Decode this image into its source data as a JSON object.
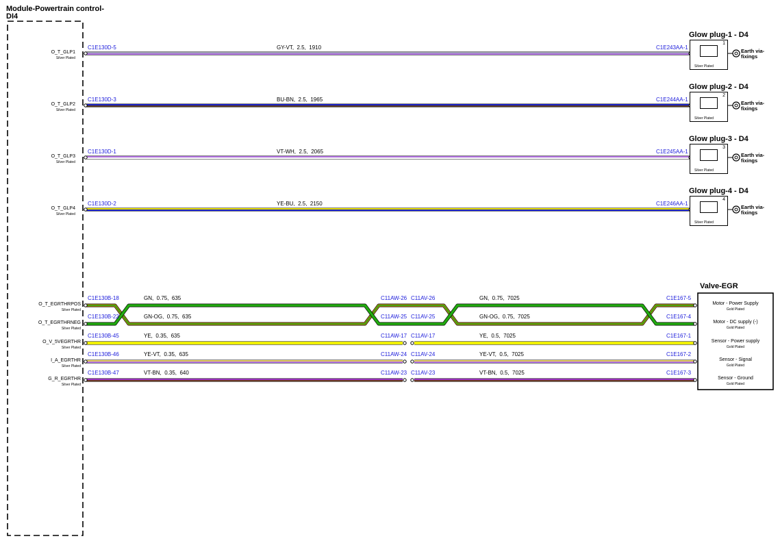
{
  "module": {
    "title_line1": "Module-Powertrain control-",
    "title_line2": "DI4"
  },
  "glow_wires": [
    {
      "pin": "O_T_GLP1",
      "plating": "Silver Plated",
      "from": "C1E130D-5",
      "spec": "GY-VT,  2.5,  1910",
      "to": "C1E243AA-1",
      "colors": [
        "#a0a0b8",
        "#b070e0"
      ],
      "plug": {
        "title": "Glow plug-1 - D4",
        "num": "1",
        "plating": "Silver Plated"
      },
      "earth": "Earth via-\nfixings"
    },
    {
      "pin": "O_T_GLP2",
      "plating": "Silver Plated",
      "from": "C1E130D-3",
      "spec": "BU-BN,  2.5,  1965",
      "to": "C1E244AA-1",
      "colors": [
        "#1a22c8",
        "#5a3a20"
      ],
      "plug": {
        "title": "Glow plug-2 - D4",
        "num": "2",
        "plating": "Silver Plated"
      },
      "earth": "Earth via-\nfixings"
    },
    {
      "pin": "O_T_GLP3",
      "plating": "Silver Plated",
      "from": "C1E130D-1",
      "spec": "VT-WH,  2.5,  2065",
      "to": "C1E245AA-1",
      "colors": [
        "#b070e0",
        "#ffffff"
      ],
      "plug": {
        "title": "Glow plug-3 - D4",
        "num": "3",
        "plating": "Silver Plated"
      },
      "earth": "Earth via-\nfixings"
    },
    {
      "pin": "O_T_GLP4",
      "plating": "Silver Plated",
      "from": "C1E130D-2",
      "spec": "YE-BU,  2.5,  2150",
      "to": "C1E246AA-1",
      "colors": [
        "#e8e000",
        "#1a22c8"
      ],
      "plug": {
        "title": "Glow plug-4 - D4",
        "num": "4",
        "plating": "Silver Plated"
      },
      "earth": "Earth via-\nfixings"
    }
  ],
  "egr": {
    "title": "Valve-EGR",
    "wires": [
      {
        "pin": "O_T_EGRTHRPOS",
        "plating": "Silver Plated",
        "from": "C1E130B-18",
        "spec1": "GN,  0.75,  635",
        "mid_a": "C11AW-26",
        "mid_b": "C11AV-26",
        "spec2": "GN,  0.75,  7025",
        "to": "C1E167-5",
        "func": "Motor - Power Supply",
        "func_plating": "Gold Plated",
        "colors": [
          "#22aa11",
          "#22aa11"
        ]
      },
      {
        "pin": "O_T_EGRTHRNEG",
        "plating": "Silver Plated",
        "from": "C1E130B-22",
        "spec1": "GN-OG,  0.75,  635",
        "mid_a": "C11AW-25",
        "mid_b": "C11AV-25",
        "spec2": "GN-OG,  0.75,  7025",
        "to": "C1E167-4",
        "func": "Motor - DC supply (-)",
        "func_plating": "Gold Plated",
        "colors": [
          "#22aa11",
          "#c08a10"
        ]
      },
      {
        "pin": "O_V_5VEGRTHR",
        "plating": "Silver Plated",
        "from": "C1E130B-45",
        "spec1": "YE,  0.35,  635",
        "mid_a": "C11AW-17",
        "mid_b": "C11AV-17",
        "spec2": "YE,  0.5,  7025",
        "to": "C1E167-1",
        "func": "Sensor - Power supply",
        "func_plating": "Gold Plated",
        "colors": [
          "#f0f000",
          "#f0f000"
        ]
      },
      {
        "pin": "I_A_EGRTHR",
        "plating": "Silver Plated",
        "from": "C1E130B-46",
        "spec1": "YE-VT,  0.35,  635",
        "mid_a": "C11AW-24",
        "mid_b": "C11AV-24",
        "spec2": "YE-VT,  0.5,  7025",
        "to": "C1E167-2",
        "func": "Sensor - Signal",
        "func_plating": "Gold Plated",
        "colors": [
          "#e8d060",
          "#b070e0"
        ]
      },
      {
        "pin": "G_R_EGRTHR",
        "plating": "Silver Plated",
        "from": "C1E130B-47",
        "spec1": "VT-BN,  0.35,  640",
        "mid_a": "C11AW-23",
        "mid_b": "C11AV-23",
        "spec2": "VT-BN,  0.5,  7025",
        "to": "C1E167-3",
        "func": "Sensor - Ground",
        "func_plating": "Gold Plated",
        "colors": [
          "#9b30c0",
          "#6a3a20"
        ]
      }
    ]
  }
}
